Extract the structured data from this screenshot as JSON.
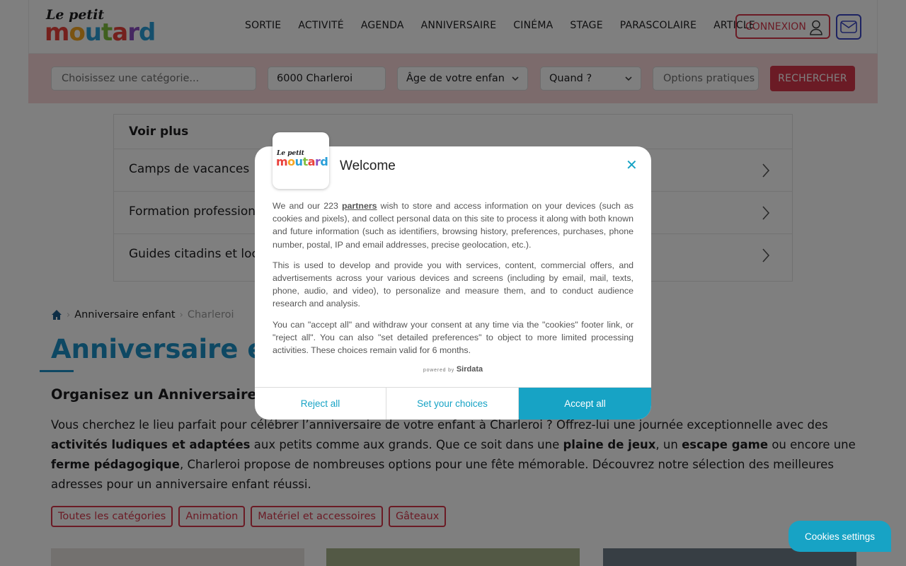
{
  "header": {
    "logo_small": "Le petit",
    "logo_big": "moutard",
    "nav": [
      "SORTIE",
      "ACTIVITÉ",
      "AGENDA",
      "ANNIVERSAIRE",
      "CINÉMA",
      "STAGE",
      "PARASCOLAIRE",
      "ARTICLE"
    ],
    "connexion_label": "CONNEXION"
  },
  "search": {
    "category_placeholder": "Choisissez une catégorie...",
    "location_value": "6000 Charleroi",
    "age_label": "Âge de votre enfan",
    "when_label": "Quand ?",
    "options_placeholder": "Options pratiques",
    "submit_label": "RECHERCHER"
  },
  "voir_plus": {
    "title": "Voir plus",
    "items": [
      "Camps de vacances",
      "Formation professionnelle",
      "Guides citadins et locaux"
    ]
  },
  "breadcrumb": {
    "level1": "Anniversaire enfant",
    "current": "Charleroi"
  },
  "page_title": "Anniversaire enfant à Charleroi",
  "subtitle": "Organisez un Anniversaire Enfant à Charleroi",
  "intro": {
    "p1": "Vous cherchez le lieu parfait pour célébrer l’anniversaire de votre enfant à Charleroi ? Offrez-lui une journée exceptionnelle avec des ",
    "b1": "activités ludiques et adaptées",
    "p2": " aux petits comme aux grands. Que ce soit dans une ",
    "b2": "plaine de jeux",
    "p3": ", un ",
    "b3": "escape game",
    "p4": " ou encore une ",
    "b4": "ferme pédagogique",
    "p5": ", Charleroi propose de nombreuses options pour une fête mémorable. Découvrez notre sélection des meilleures adresses pour un anniversaire enfant réussi."
  },
  "chips": [
    "Toutes les catégories",
    "Animation",
    "Matériel et accessoires",
    "Gâteaux"
  ],
  "consent": {
    "title": "Welcome",
    "close": "✕",
    "p1_before": "We and our 223 ",
    "p1_link": "partners",
    "p1_after": " wish to store and access information on your devices (such as cookies and pixels), and collect personal data on this site to process it along with both known and future information (such as identifiers, browsing history, preferences, purchases, phone number, postal, IP and email addresses, precise geolocation, etc.).",
    "p2": "This is used to develop and provide you with services, content, commercial offers, and advertisements across your various devices and screens (including by email, mail, texts, phone, audio, and video), to personalize and measure them, and to conduct audience research and analysis.",
    "p3": "You can \"accept all\" and withdraw your consent at any time via the \"cookies\" footer link, or \"reject all\". You can also \"set detailed preferences\" to object to more limited processing activities. These choices remain valid for 6 months.",
    "powered_by": "powered by",
    "powered_brand": "Sirdata",
    "reject": "Reject all",
    "choices": "Set your choices",
    "accept": "Accept all"
  },
  "cookies_settings": "Cookies settings",
  "colors": {
    "brand_red": "#d6364b",
    "title_blue": "#1c90c7",
    "consent_accent": "#17a3c5",
    "search_bg": "#f9d6d9"
  }
}
